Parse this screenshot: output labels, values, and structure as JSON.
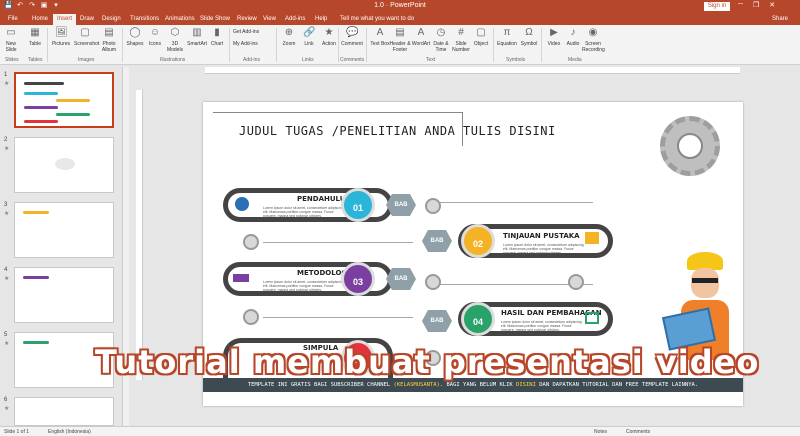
{
  "window": {
    "title": "1.0 · PowerPoint",
    "signin": "Sign in",
    "min": "─",
    "restore": "❐",
    "close": "✕",
    "qat": [
      "💾",
      "↶",
      "↷",
      "▣",
      "▾"
    ]
  },
  "tabs": [
    "File",
    "Home",
    "Insert",
    "Draw",
    "Design",
    "Transitions",
    "Animations",
    "Slide Show",
    "Review",
    "View",
    "Add-ins",
    "Help",
    "Tell me what you want to do"
  ],
  "active_tab": "Insert",
  "share": "Share",
  "ribbon": {
    "buttons": [
      {
        "label": "New Slide",
        "icon": "▭"
      },
      {
        "label": "Table",
        "icon": "▦"
      },
      {
        "label": "Pictures",
        "icon": "🖼"
      },
      {
        "label": "Screenshot",
        "icon": "▢"
      },
      {
        "label": "Photo Album",
        "icon": "▤"
      },
      {
        "label": "Shapes",
        "icon": "◯"
      },
      {
        "label": "Icons",
        "icon": "☺"
      },
      {
        "label": "3D Models",
        "icon": "⬡"
      },
      {
        "label": "SmartArt",
        "icon": "▥"
      },
      {
        "label": "Chart",
        "icon": "▮"
      },
      {
        "label": "Zoom",
        "icon": "⊕"
      },
      {
        "label": "Link",
        "icon": "🔗"
      },
      {
        "label": "Action",
        "icon": "★"
      },
      {
        "label": "Comment",
        "icon": "💬"
      },
      {
        "label": "Text Box",
        "icon": "A"
      },
      {
        "label": "Header & Footer",
        "icon": "▤"
      },
      {
        "label": "WordArt",
        "icon": "A"
      },
      {
        "label": "Date & Time",
        "icon": "◷"
      },
      {
        "label": "Slide Number",
        "icon": "#"
      },
      {
        "label": "Object",
        "icon": "▢"
      },
      {
        "label": "Equation",
        "icon": "π"
      },
      {
        "label": "Symbol",
        "icon": "Ω"
      },
      {
        "label": "Video",
        "icon": "▶"
      },
      {
        "label": "Audio",
        "icon": "♪"
      },
      {
        "label": "Screen Recording",
        "icon": "◉"
      }
    ],
    "addins": {
      "get": "Get Add-ins",
      "my": "My Add-ins"
    },
    "groups": [
      "Slides",
      "Tables",
      "Images",
      "Illustrations",
      "Add-ins",
      "Links",
      "Comments",
      "Text",
      "Symbols",
      "Media"
    ]
  },
  "thumbnails": [
    {
      "num": "1",
      "star": "★"
    },
    {
      "num": "2",
      "star": "★"
    },
    {
      "num": "3",
      "star": "★"
    },
    {
      "num": "4",
      "star": "★"
    },
    {
      "num": "5",
      "star": "★"
    },
    {
      "num": "6",
      "star": "★"
    }
  ],
  "slide": {
    "title": "JUDUL TUGAS /PENELITIAN ANDA TULIS DISINI",
    "items": [
      {
        "heading": "PENDAHULUAN",
        "num": "01",
        "bab": "BAB",
        "color": "#2bb5d8",
        "text": "Lorem ipsum dolor sit amet, consectetuer adipiscing elit. Maecenas porttitor congue massa. Fusce posuere, magna sed pulvinar ultricies."
      },
      {
        "heading": "TINJAUAN PUSTAKA",
        "num": "02",
        "bab": "BAB",
        "color": "#f4b324",
        "text": "Lorem ipsum dolor sit amet, consectetuer adipiscing elit. Maecenas porttitor congue massa. Fusce posuere, magna sed pulvinar ultricies."
      },
      {
        "heading": "METODOLOGI",
        "num": "03",
        "bab": "BAB",
        "color": "#7a3fa0",
        "text": "Lorem ipsum dolor sit amet, consectetuer adipiscing elit. Maecenas porttitor congue massa. Fusce posuere, magna sed pulvinar ultricies."
      },
      {
        "heading": "HASIL DAN PEMBAHASAN",
        "num": "04",
        "bab": "BAB",
        "color": "#29a36a",
        "text": "Lorem ipsum dolor sit amet, consectetuer adipiscing elit. Maecenas porttitor congue massa. Fusce posuere, magna sed pulvinar ultricies."
      },
      {
        "heading": "SIMPULA",
        "num": "05",
        "bab": "BAB",
        "color": "#e2343c",
        "text": ""
      }
    ],
    "banner": {
      "pre": "TEMPLATE INI GRATIS BAGI SUBSCRIBER CHANNEL",
      "hl1": "(KELASMUSANTA)",
      "mid": ". BAGI YANG BELUM KLIK",
      "hl2": "DISINI",
      "post": "DAN DAPATKAN TUTORIAL DAN FREE TEMPLATE LAINNYA."
    }
  },
  "caption": "Tutorial membuat presentasi video",
  "status": {
    "slide": "Slide 1 of 1",
    "lang": "English (Indonesia)",
    "notes": "Notes",
    "comments": "Comments"
  }
}
